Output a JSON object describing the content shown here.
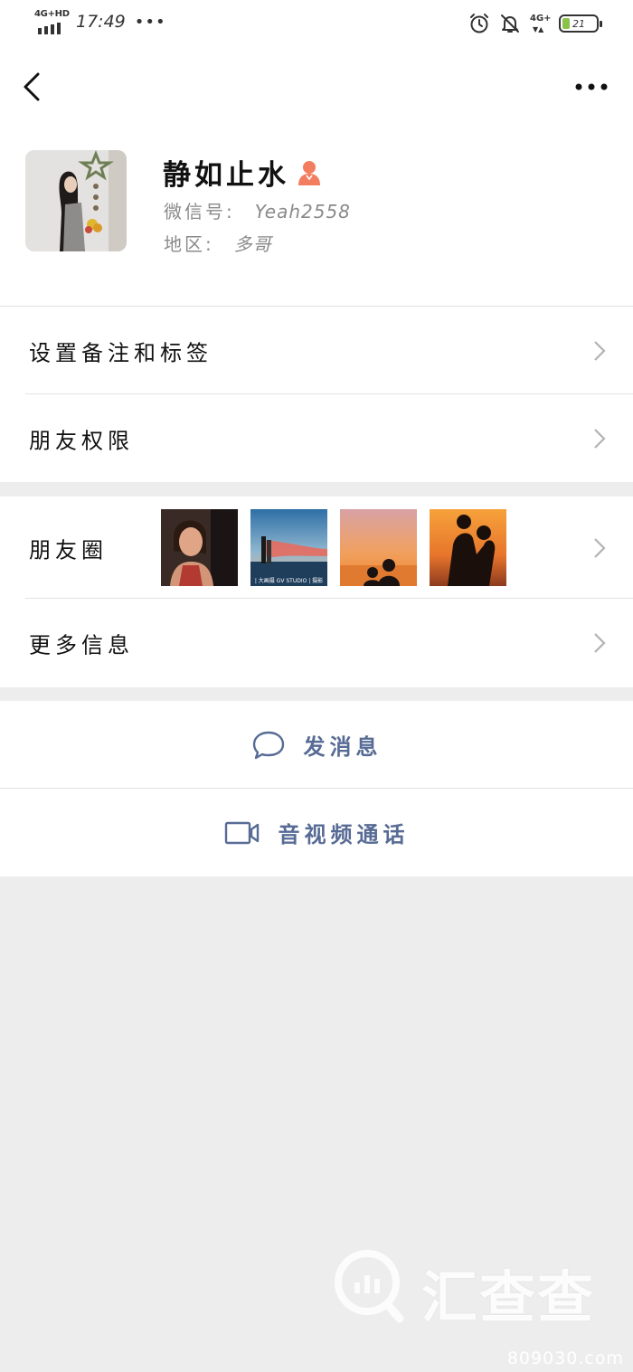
{
  "status_bar": {
    "network_left": "4G+HD",
    "time": "17:49",
    "more_dots": "•••",
    "network_right": "4G+",
    "battery": "21"
  },
  "profile": {
    "nickname": "静如止水",
    "wechat_id_label": "微信号:",
    "wechat_id": "Yeah2558",
    "region_label": "地区:",
    "region": "多哥",
    "gender": "female"
  },
  "menu": {
    "remark_tags": "设置备注和标签",
    "permissions": "朋友权限",
    "moments": "朋友圈",
    "more_info": "更多信息"
  },
  "moments_thumbs": [
    {
      "name": "moments-photo-1",
      "caption": ""
    },
    {
      "name": "moments-photo-2",
      "caption": "| 大画摄 GV STUDIO | 摄影"
    },
    {
      "name": "moments-photo-3",
      "caption": ""
    },
    {
      "name": "moments-photo-4",
      "caption": ""
    }
  ],
  "actions": {
    "send_message": "发消息",
    "video_call": "音视频通话"
  },
  "watermark": {
    "brand": "汇查查",
    "site": "809030.com"
  },
  "colors": {
    "link_blue": "#576b95",
    "gender_female": "#f37e5f",
    "background": "#ededed"
  }
}
